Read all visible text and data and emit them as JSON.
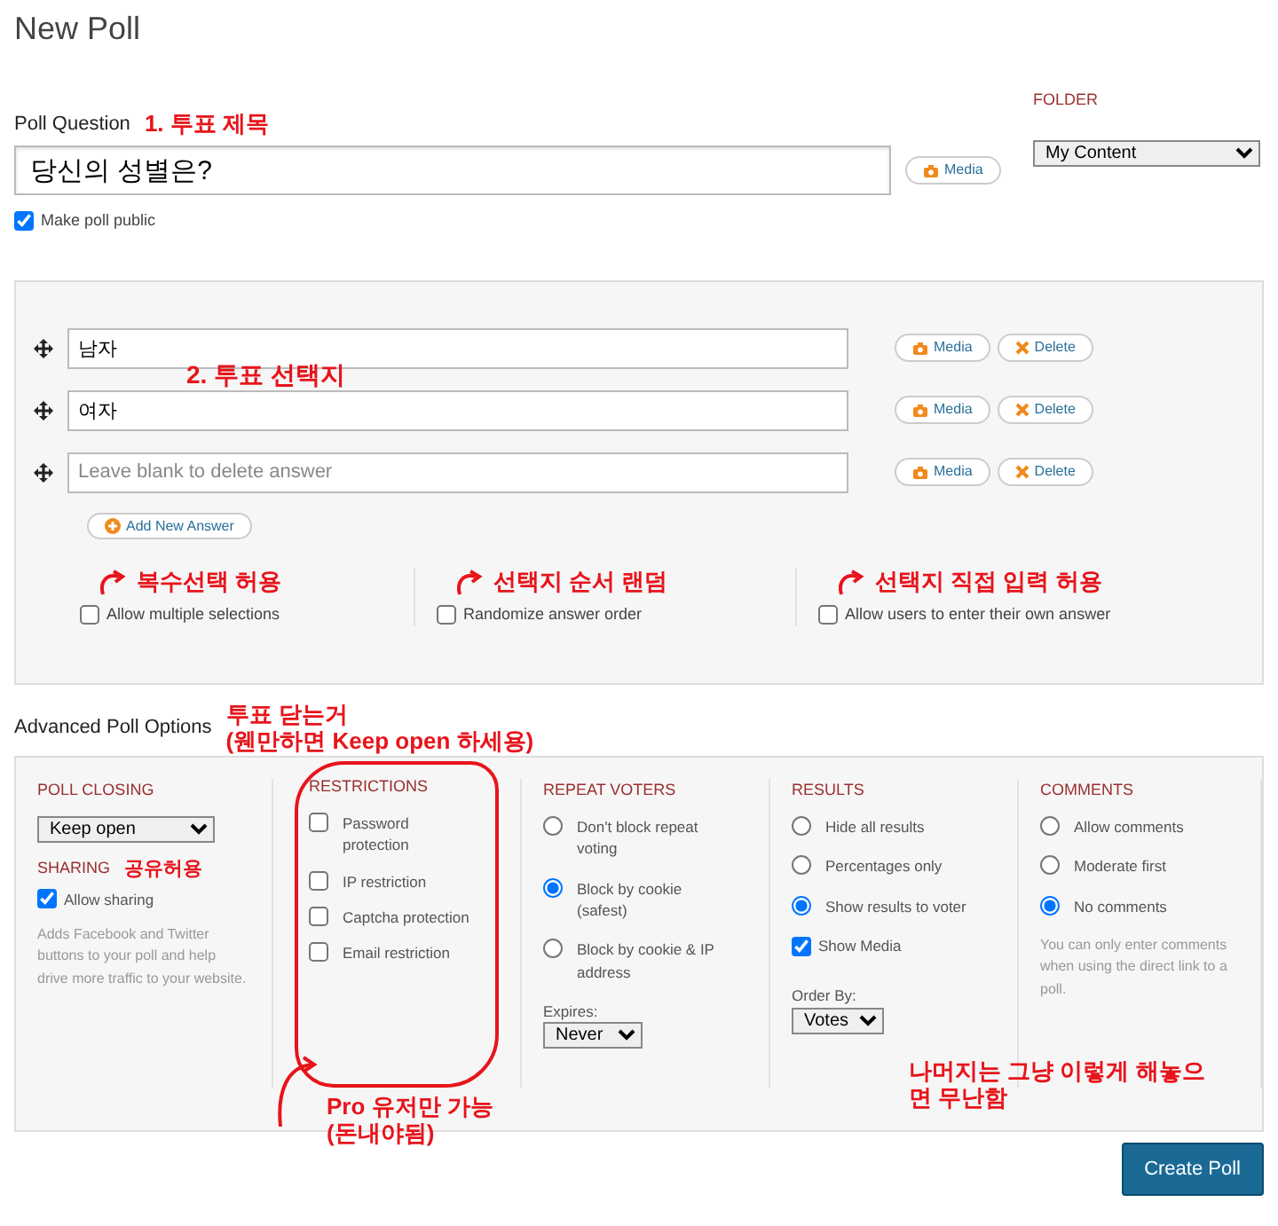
{
  "title": "New Poll",
  "question": {
    "label": "Poll Question",
    "annotation": "1. 투표 제목",
    "value": "당신의 성별은?",
    "media_button": "Media"
  },
  "make_public": {
    "label": "Make poll public",
    "checked": true
  },
  "folder": {
    "label": "FOLDER",
    "value": "My Content"
  },
  "answers_annotation": "2. 투표 선택지",
  "answers": [
    {
      "value": "남자",
      "media_button": "Media",
      "delete_button": "Delete"
    },
    {
      "value": "여자",
      "media_button": "Media",
      "delete_button": "Delete"
    },
    {
      "placeholder": "Leave blank to delete answer",
      "media_button": "Media",
      "delete_button": "Delete"
    }
  ],
  "add_answer_button": "Add New Answer",
  "answer_options": [
    {
      "label": "Allow multiple selections",
      "checked": false,
      "annotation": "복수선택 허용"
    },
    {
      "label": "Randomize answer order",
      "checked": false,
      "annotation": "선택지 순서 랜덤"
    },
    {
      "label": "Allow users to enter their own answer",
      "checked": false,
      "annotation": "선택지 직접 입력 허용"
    }
  ],
  "advanced": {
    "heading": "Advanced Poll Options",
    "annotation_lines": [
      "투표 닫는거",
      "(웬만하면 Keep open 하세용)"
    ]
  },
  "poll_closing": {
    "heading": "POLL CLOSING",
    "value": "Keep open"
  },
  "sharing": {
    "heading": "SHARING",
    "label": "Allow sharing",
    "checked": true,
    "annotation": "공유허용",
    "help": "Adds Facebook and Twitter buttons to your poll and help drive more traffic to your website."
  },
  "restrictions": {
    "heading": "RESTRICTIONS",
    "items": [
      {
        "label": "Password protection",
        "checked": false
      },
      {
        "label": "IP restriction",
        "checked": false
      },
      {
        "label": "Captcha protection",
        "checked": false
      },
      {
        "label": "Email restriction",
        "checked": false
      }
    ],
    "annotation_lines": [
      "Pro 유저만 가능",
      "(돈내야됨)"
    ]
  },
  "repeat_voters": {
    "heading": "REPEAT VOTERS",
    "options": [
      {
        "label": "Don't block repeat voting",
        "selected": false
      },
      {
        "label": "Block by cookie (safest)",
        "selected": true
      },
      {
        "label": "Block by cookie & IP address",
        "selected": false
      }
    ],
    "expires_label": "Expires:",
    "expires_value": "Never"
  },
  "results": {
    "heading": "RESULTS",
    "options": [
      {
        "label": "Hide all results",
        "selected": false
      },
      {
        "label": "Percentages only",
        "selected": false
      },
      {
        "label": "Show results to voter",
        "selected": true
      }
    ],
    "show_media": {
      "label": "Show Media",
      "checked": true
    },
    "order_label": "Order By:",
    "order_value": "Votes"
  },
  "comments": {
    "heading": "COMMENTS",
    "options": [
      {
        "label": "Allow comments",
        "selected": false
      },
      {
        "label": "Moderate first",
        "selected": false
      },
      {
        "label": "No comments",
        "selected": true
      }
    ],
    "help": "You can only enter comments when using the direct link to a poll."
  },
  "closing_annotation": "나머지는 그냥 이렇게 해놓으면 무난함",
  "create_button": "Create Poll"
}
